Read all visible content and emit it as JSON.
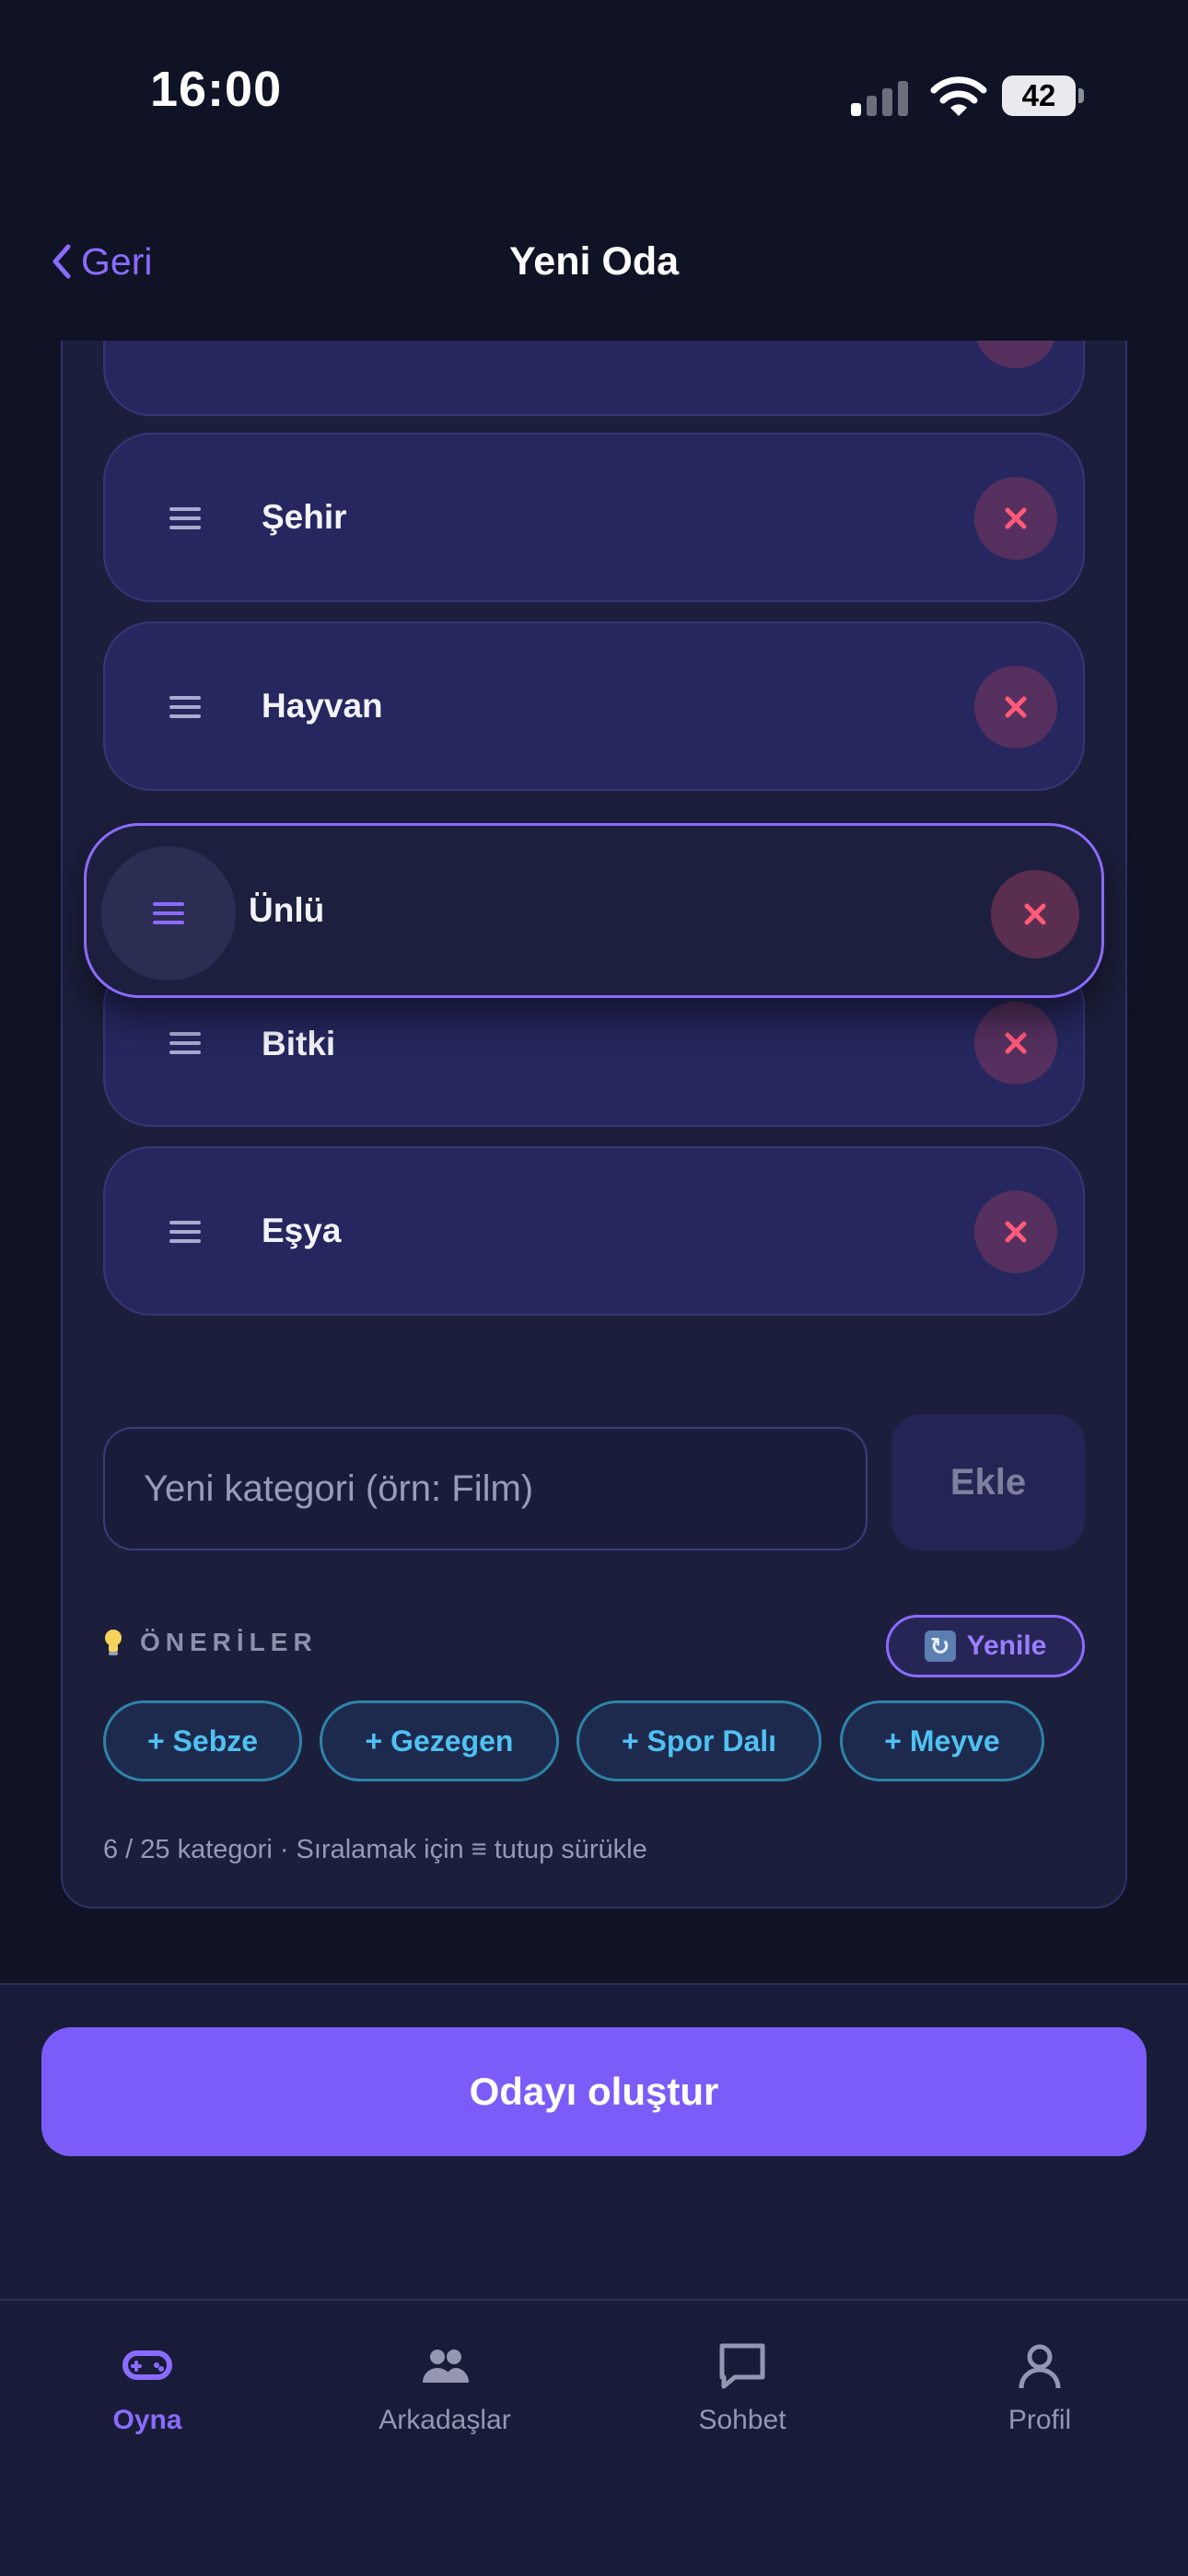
{
  "status_bar": {
    "time": "16:00",
    "battery": "42"
  },
  "header": {
    "back_label": "Geri",
    "title": "Yeni Oda"
  },
  "categories": [
    {
      "label": "Şehir"
    },
    {
      "label": "Hayvan"
    },
    {
      "label": "Ünlü",
      "dragging": true
    },
    {
      "label": "Bitki"
    },
    {
      "label": "Eşya"
    }
  ],
  "new_category": {
    "placeholder": "Yeni kategori (örn: Film)",
    "add_label": "Ekle"
  },
  "suggestions": {
    "title": "ÖNERİLER",
    "refresh_label": "Yenile",
    "chips": [
      "+ Sebze",
      "+ Gezegen",
      "+ Spor Dalı",
      "+ Meyve"
    ]
  },
  "hint": "6 / 25 kategori · Sıralamak için ≡ tutup sürükle",
  "create_button": "Odayı oluştur",
  "tabs": [
    {
      "label": "Oyna",
      "icon": "gamepad-icon",
      "active": true
    },
    {
      "label": "Arkadaşlar",
      "icon": "friends-icon",
      "active": false
    },
    {
      "label": "Sohbet",
      "icon": "chat-icon",
      "active": false
    },
    {
      "label": "Profil",
      "icon": "profile-icon",
      "active": false
    }
  ],
  "colors": {
    "accent": "#7c5cf9",
    "background": "#0f1325",
    "chip": "#4fc1f2",
    "delete": "#ff5a7a"
  }
}
